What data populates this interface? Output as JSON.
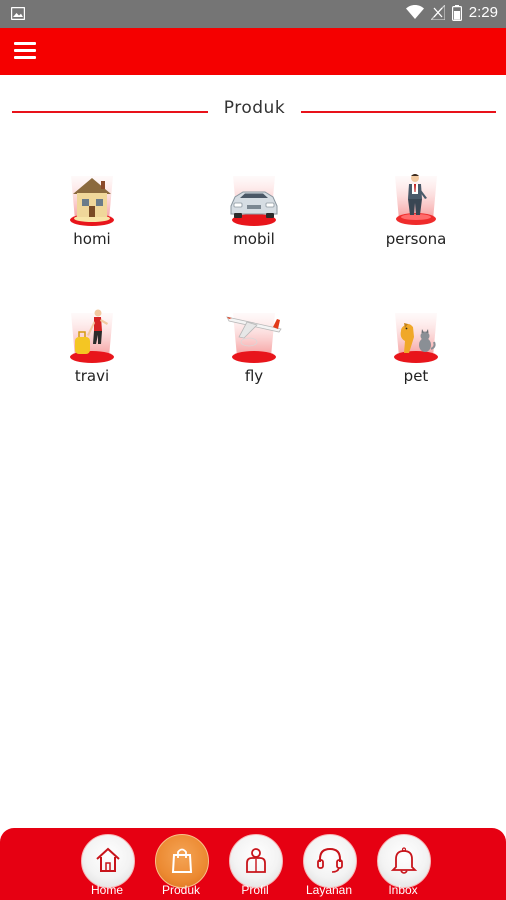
{
  "status_bar": {
    "time": "2:29",
    "icons": [
      "image-icon",
      "wifi-icon",
      "no-signal-icon",
      "battery-icon"
    ]
  },
  "app_bar": {
    "menu_icon": "hamburger-icon",
    "color": "#f50000"
  },
  "section": {
    "title": "Produk"
  },
  "products": [
    {
      "label": "homi",
      "icon": "house-icon"
    },
    {
      "label": "mobil",
      "icon": "car-icon"
    },
    {
      "label": "persona",
      "icon": "person-icon"
    },
    {
      "label": "travi",
      "icon": "traveler-icon"
    },
    {
      "label": "fly",
      "icon": "airplane-icon"
    },
    {
      "label": "pet",
      "icon": "pet-icon"
    }
  ],
  "bottom_nav": {
    "active": "Produk",
    "items": [
      {
        "label": "Home",
        "icon": "home-icon"
      },
      {
        "label": "Produk",
        "icon": "shopping-bag-icon"
      },
      {
        "label": "Profil",
        "icon": "profile-icon"
      },
      {
        "label": "Layanan",
        "icon": "headset-icon"
      },
      {
        "label": "Inbox",
        "icon": "bell-icon"
      }
    ]
  },
  "colors": {
    "accent": "#e60012",
    "active_nav": "#ec8a32"
  }
}
